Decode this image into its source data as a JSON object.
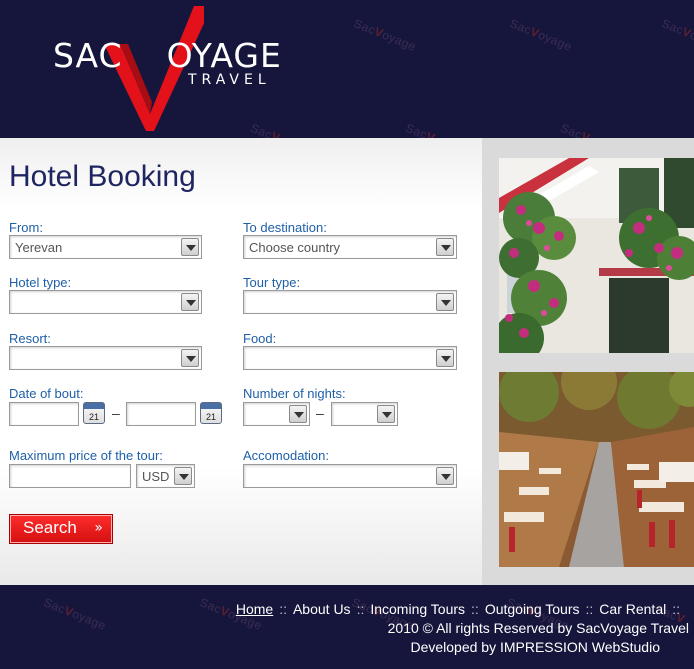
{
  "brand": {
    "name_left": "SAC",
    "name_right": "OYAGE",
    "tagline": "TRAVEL",
    "watermark": "SacVoyage",
    "accent": "#e3121a",
    "navy": "#16163d"
  },
  "page": {
    "title": "Hotel Booking"
  },
  "form": {
    "from": {
      "label": "From:",
      "value": "Yerevan"
    },
    "to_destination": {
      "label": "To destination:",
      "value": "Choose country"
    },
    "hotel_type": {
      "label": "Hotel type:",
      "value": ""
    },
    "tour_type": {
      "label": "Tour type:",
      "value": ""
    },
    "resort": {
      "label": "Resort:",
      "value": ""
    },
    "food": {
      "label": "Food:",
      "value": ""
    },
    "date_of_bout": {
      "label": "Date of bout:",
      "from_value": "",
      "to_value": "",
      "calendar_day": "21",
      "dash": "–"
    },
    "number_of_nights": {
      "label": "Number of nights:",
      "from_value": "",
      "to_value": "",
      "dash": "–"
    },
    "max_price": {
      "label": "Maximum price of the tour:",
      "value": "",
      "currency": "USD"
    },
    "accomodation": {
      "label": "Accomodation:",
      "value": ""
    },
    "search_button": {
      "label": "Search",
      "chevron": "»"
    }
  },
  "footer": {
    "nav": [
      "Home",
      "About Us",
      "Incoming Tours",
      "Outgoing Tours",
      "Car Rental"
    ],
    "separator": "::",
    "copyright": "2010 © All rights Reserved by SacVoyage Travel",
    "developer": "Developed by IMPRESSION WebStudio"
  },
  "icons": {
    "dropdown": "chevron-down-icon",
    "calendar": "calendar-icon",
    "logo_mark": "checkmark-v-logo"
  }
}
